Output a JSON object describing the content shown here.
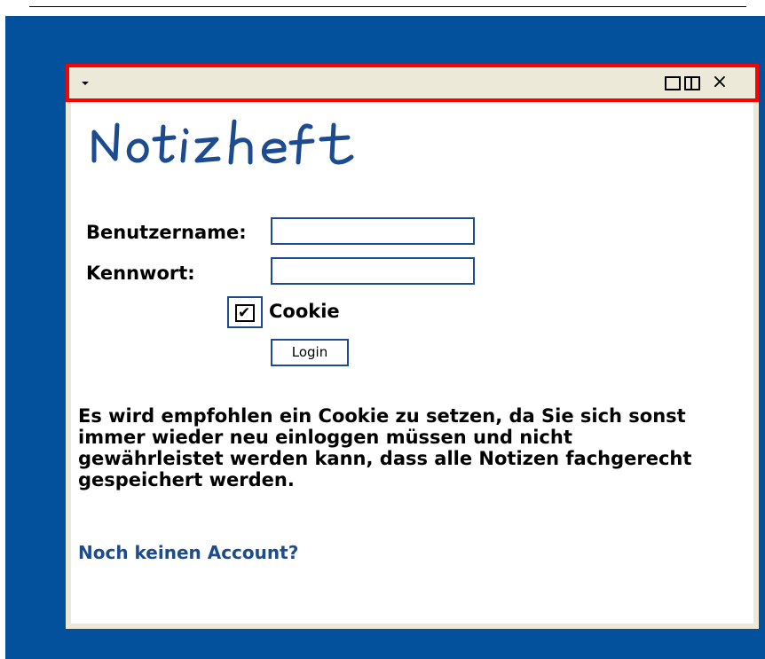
{
  "window": {
    "titlebar": {
      "menu_icon": "dropdown-arrow-icon",
      "maximize_icon": "maximize-icon",
      "tile_icon": "tile-icon",
      "close_icon": "close-icon",
      "close_glyph": "×",
      "highlight_color": "#ff0000"
    }
  },
  "app": {
    "logo_text": "Notizheft",
    "logo_color": "#1d4b8f"
  },
  "login_form": {
    "username_label": "Benutzername:",
    "username_value": "",
    "password_label": "Kennwort:",
    "password_value": "",
    "cookie_label": "Cookie",
    "cookie_checked": true,
    "login_button_label": "Login"
  },
  "info_text": "Es wird empfohlen ein Cookie zu setzen, da Sie sich sonst immer wieder neu einloggen müssen und nicht gewährleistet werden kann, dass alle Notizen fachgerecht gespeichert werden.",
  "signup_link_text": "Noch keinen Account?",
  "colors": {
    "desktop_background": "#03509c",
    "window_frame": "#ece9d8",
    "accent": "#1d4b8f",
    "highlight": "#ff0000"
  }
}
